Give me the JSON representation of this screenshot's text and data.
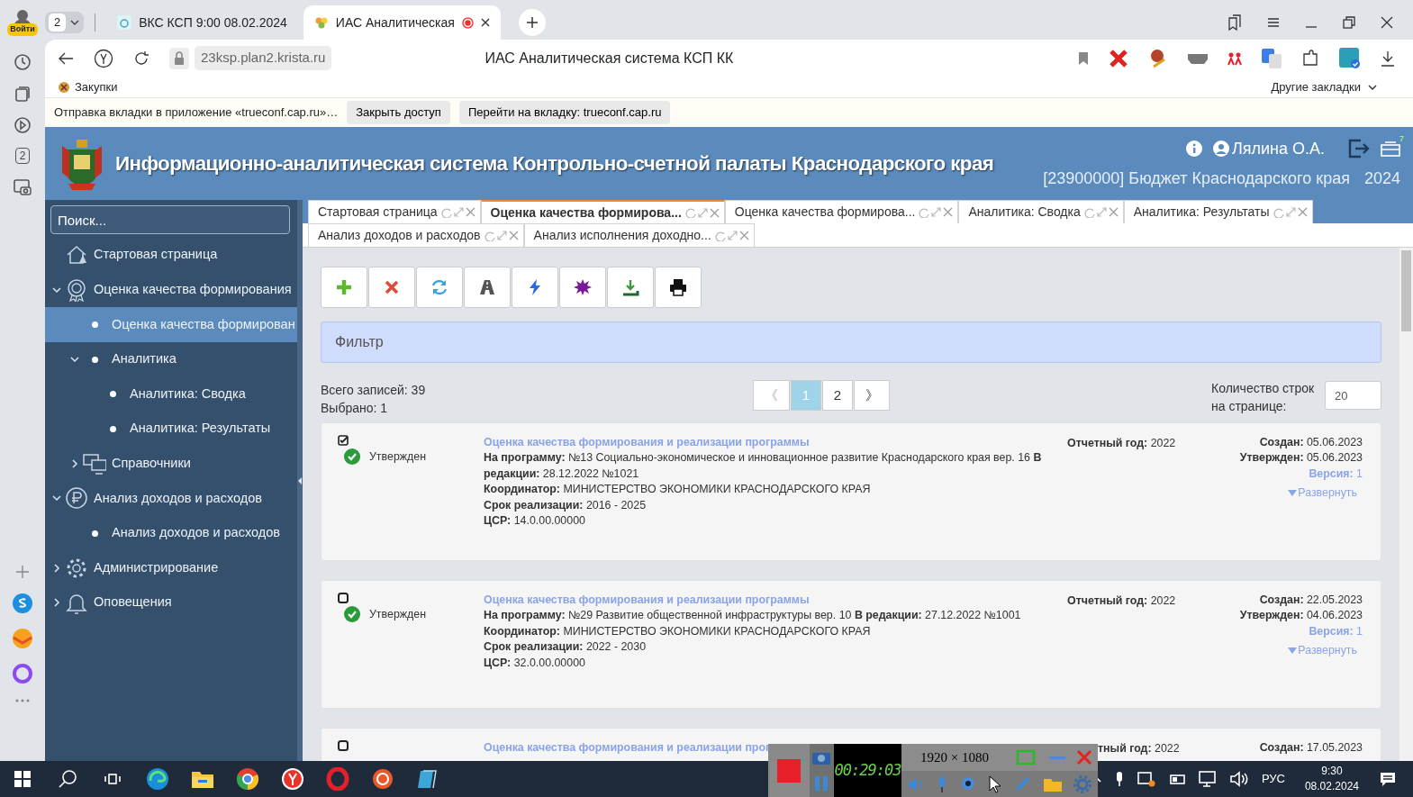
{
  "browser": {
    "profile_badge": "Войти",
    "tab_group_count": "2",
    "tabs": [
      {
        "title": "ВКС КСП 9:00 08.02.2024",
        "selected": false,
        "recording": false
      },
      {
        "title": "ИАС Аналитическая",
        "selected": true,
        "recording": true
      }
    ],
    "url": "23ksp.plan2.krista.ru",
    "page_title": "ИАС Аналитическая система КСП КК",
    "bookmarks": [
      "Закупки"
    ],
    "other_bookmarks": "Другие закладки",
    "notification": {
      "text": "Отправка вкладки в приложение «trueconf.cap.ru»…",
      "buttons": [
        "Закрыть доступ",
        "Перейти на вкладку: trueconf.cap.ru"
      ]
    },
    "rail_tab_count": "2"
  },
  "app": {
    "title": "Информационно-аналитическая система Контрольно-счетной палаты Краснодарского края",
    "user": "Лялина О.А.",
    "tasks_count": "7",
    "budget": "[23900000] Бюджет Краснодарского края",
    "year": "2024"
  },
  "sidebar": {
    "search_placeholder": "Поиск...",
    "items": [
      {
        "label": "Стартовая страница",
        "kind": "home",
        "selected": false
      },
      {
        "label": "Оценка качества формирования",
        "kind": "award",
        "selected": false,
        "expanded": true,
        "children": [
          {
            "label": "Оценка качества формирован",
            "kind": "bullet",
            "selected": true
          },
          {
            "label": "Аналитика",
            "kind": "bullet",
            "selected": false,
            "expanded": true,
            "children": [
              {
                "label": "Аналитика: Сводка",
                "kind": "bullet",
                "selected": false
              },
              {
                "label": "Аналитика: Результаты",
                "kind": "bullet",
                "selected": false
              }
            ]
          },
          {
            "label": "Справочники",
            "kind": "screens",
            "selected": false,
            "expanded": false
          }
        ]
      },
      {
        "label": "Анализ доходов и расходов",
        "kind": "ruble",
        "selected": false,
        "expanded": true,
        "children": [
          {
            "label": "Анализ доходов и расходов",
            "kind": "bullet",
            "selected": false
          }
        ]
      },
      {
        "label": "Администрирование",
        "kind": "gear",
        "selected": false,
        "expanded": false
      },
      {
        "label": "Оповещения",
        "kind": "bell",
        "selected": false,
        "expanded": false
      }
    ]
  },
  "tab_rows": [
    [
      {
        "label": "Стартовая страница",
        "selected": false
      },
      {
        "label": "Оценка качества формирова...",
        "selected": true
      },
      {
        "label": "Оценка качества формирова...",
        "selected": false
      },
      {
        "label": "Аналитика: Сводка",
        "selected": false
      },
      {
        "label": "Аналитика: Результаты",
        "selected": false
      }
    ],
    [
      {
        "label": "Анализ доходов и расходов",
        "selected": false
      },
      {
        "label": "Анализ исполнения доходно...",
        "selected": false
      }
    ]
  ],
  "toolbar": [
    {
      "kind": "add"
    },
    {
      "kind": "delete"
    },
    {
      "kind": "refresh"
    },
    {
      "kind": "road"
    },
    {
      "kind": "flash"
    },
    {
      "kind": "splash"
    },
    {
      "kind": "export"
    },
    {
      "kind": "print"
    }
  ],
  "filter": "Фильтр",
  "summary": {
    "total": "Всего записей: 39",
    "selected": "Выбрано: 1"
  },
  "pagination": {
    "prev": "《",
    "pages": [
      {
        "label": "1",
        "selected": true
      },
      {
        "label": "2",
        "selected": false
      }
    ],
    "next": "》"
  },
  "page_size": {
    "label": "Количество строк на странице:",
    "value": "20"
  },
  "records": [
    {
      "checked": true,
      "status": "Утвержден",
      "title": "Оценка качества формирования и реализации программы",
      "lines": [
        "**На программу:** №13 Социально-экономическое и инновационное развитие Краснодарского края вер. 16 **В редакции:** 28.12.2022 №1021",
        "**Координатор:** МИНИСТЕРСТВО ЭКОНОМИКИ КРАСНОДАРСКОГО КРАЯ",
        "**Срок реализации:** 2016 - 2025",
        "**ЦСР:** 14.0.00.00000"
      ],
      "year": "**Отчетный год:** 2022",
      "created": "**Создан:** 05.06.2023",
      "approved": "**Утвержден:** 05.06.2023",
      "version": "**Версия:** 1",
      "expand": "Развернуть"
    },
    {
      "checked": false,
      "status": "Утвержден",
      "title": "Оценка качества формирования и реализации программы",
      "lines": [
        "**На программу:** №29 Развитие общественной инфраструктуры вер. 10 **В редакции:** 27.12.2022 №1001",
        "**Координатор:** МИНИСТЕРСТВО ЭКОНОМИКИ КРАСНОДАРСКОГО КРАЯ",
        "**Срок реализации:** 2022 - 2030",
        "**ЦСР:** 32.0.00.00000"
      ],
      "year": "**Отчетный год:** 2022",
      "created": "**Создан:** 22.05.2023",
      "approved": "**Утвержден:** 04.06.2023",
      "version": "**Версия:** 1",
      "expand": "Развернуть"
    },
    {
      "checked": false,
      "title": "Оценка качества формирования и реализации прог",
      "year": "**тный год:** 2022",
      "created": "**Создан:** 17.05.2023"
    }
  ],
  "recorder": {
    "timer": "00:29:03",
    "resolution": "1920 × 1080"
  },
  "taskbar": {
    "language": "РУС",
    "time": "9:30",
    "date": "08.02.2024"
  }
}
